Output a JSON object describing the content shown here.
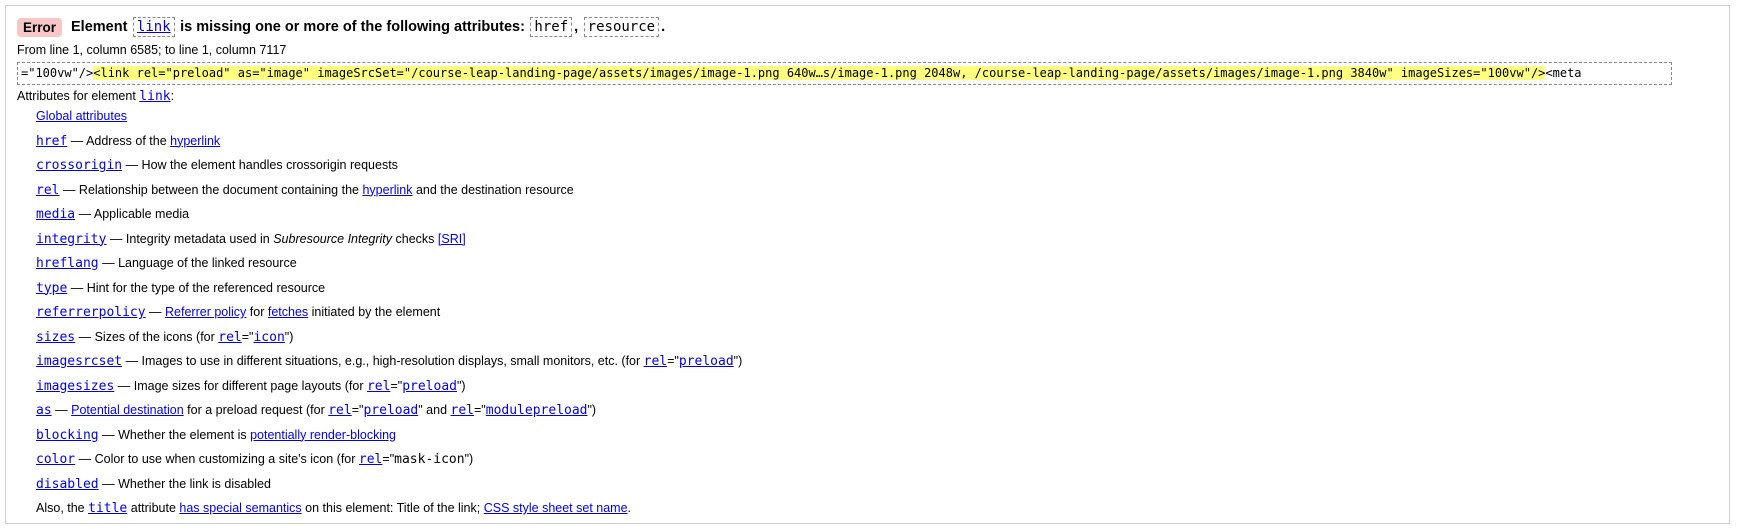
{
  "error": {
    "badge": "Error",
    "prefix": "Element",
    "element": "link",
    "message": "is missing one or more of the following attributes:",
    "attr1": "href",
    "sep": ",",
    "attr2": "resource",
    "end": "."
  },
  "location": "From line 1, column 6585; to line 1, column 7117",
  "extract": {
    "before": "=\"100vw\"/>",
    "highlight": "<link rel=\"preload\" as=\"image\" imageSrcSet=\"/course-leap-landing-page/assets/images/image-1.png 640w…s/image-1.png 2048w, /course-leap-landing-page/assets/images/image-1.png 3840w\" imageSizes=\"100vw\"/>",
    "after": "<meta"
  },
  "attributes_header": {
    "prefix": "Attributes for element",
    "element": "link",
    "suffix": ":"
  },
  "global_link": "Global attributes",
  "attrs": {
    "href": {
      "name": "href",
      "t1": " — Address of the ",
      "l1": "hyperlink"
    },
    "crossorigin": {
      "name": "crossorigin",
      "t1": " — How the element handles crossorigin requests"
    },
    "rel": {
      "name": "rel",
      "t1": " — Relationship between the document containing the ",
      "l1": "hyperlink",
      "t2": " and the destination resource"
    },
    "media": {
      "name": "media",
      "t1": " — Applicable media"
    },
    "integrity": {
      "name": "integrity",
      "t1": " — Integrity metadata used in ",
      "em": "Subresource Integrity",
      "t2": " checks ",
      "l1": "[SRI]"
    },
    "hreflang": {
      "name": "hreflang",
      "t1": " — Language of the linked resource"
    },
    "type": {
      "name": "type",
      "t1": " — Hint for the type of the referenced resource"
    },
    "referrerpolicy": {
      "name": "referrerpolicy",
      "t1": " — ",
      "l1": "Referrer policy",
      "t2": " for ",
      "l2": "fetches",
      "t3": " initiated by the element"
    },
    "sizes": {
      "name": "sizes",
      "t1": " — Sizes of the icons (for ",
      "r1": "rel",
      "q1": "=\"",
      "v1": "icon",
      "q2": "\")"
    },
    "imagesrcset": {
      "name": "imagesrcset",
      "t1": " — Images to use in different situations, e.g., high-resolution displays, small monitors, etc. (for ",
      "r1": "rel",
      "q1": "=\"",
      "v1": "preload",
      "q2": "\")"
    },
    "imagesizes": {
      "name": "imagesizes",
      "t1": " — Image sizes for different page layouts (for ",
      "r1": "rel",
      "q1": "=\"",
      "v1": "preload",
      "q2": "\")"
    },
    "as": {
      "name": "as",
      "t1": " — ",
      "l1": "Potential destination",
      "t2": " for a preload request (for ",
      "r1": "rel",
      "q1": "=\"",
      "v1": "preload",
      "q2": "\" and ",
      "r2": "rel",
      "q3": "=\"",
      "v2": "modulepreload",
      "q4": "\")"
    },
    "blocking": {
      "name": "blocking",
      "t1": " — Whether the element is ",
      "l1": "potentially render-blocking"
    },
    "color": {
      "name": "color",
      "t1": " — Color to use when customizing a site's icon (for ",
      "r1": "rel",
      "q1": "=\"",
      "v1": "mask-icon",
      "q2": "\")"
    },
    "disabled": {
      "name": "disabled",
      "t1": " — Whether the link is disabled"
    }
  },
  "also": {
    "t1": "Also, the ",
    "attr": "title",
    "t2": " attribute ",
    "l1": "has special semantics",
    "t3": " on this element: Title of the link; ",
    "l2": "CSS style sheet set name",
    "t4": "."
  }
}
